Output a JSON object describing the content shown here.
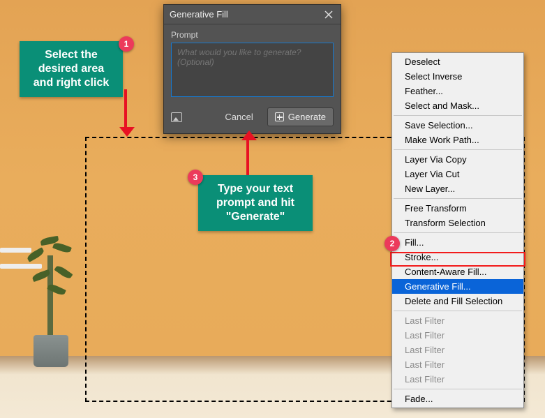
{
  "dialog": {
    "title": "Generative Fill",
    "prompt_label": "Prompt",
    "prompt_placeholder": "What would you like to generate? (Optional)",
    "cancel_label": "Cancel",
    "generate_label": "Generate"
  },
  "context_menu": {
    "groups": [
      [
        "Deselect",
        "Select Inverse",
        "Feather...",
        "Select and Mask..."
      ],
      [
        "Save Selection...",
        "Make Work Path..."
      ],
      [
        "Layer Via Copy",
        "Layer Via Cut",
        "New Layer..."
      ],
      [
        "Free Transform",
        "Transform Selection"
      ],
      [
        "Fill...",
        "Stroke...",
        "Content-Aware Fill...",
        "Generative Fill...",
        "Delete and Fill Selection"
      ],
      [
        "Last Filter",
        "Last Filter",
        "Last Filter",
        "Last Filter",
        "Last Filter"
      ],
      [
        "Fade..."
      ]
    ],
    "highlighted": "Generative Fill...",
    "disabled_group_index": 5
  },
  "callouts": {
    "c1": "Select the desired area and right click",
    "c3": "Type your text prompt and hit \"Generate\""
  },
  "badges": {
    "b1": "1",
    "b2": "2",
    "b3": "3"
  }
}
